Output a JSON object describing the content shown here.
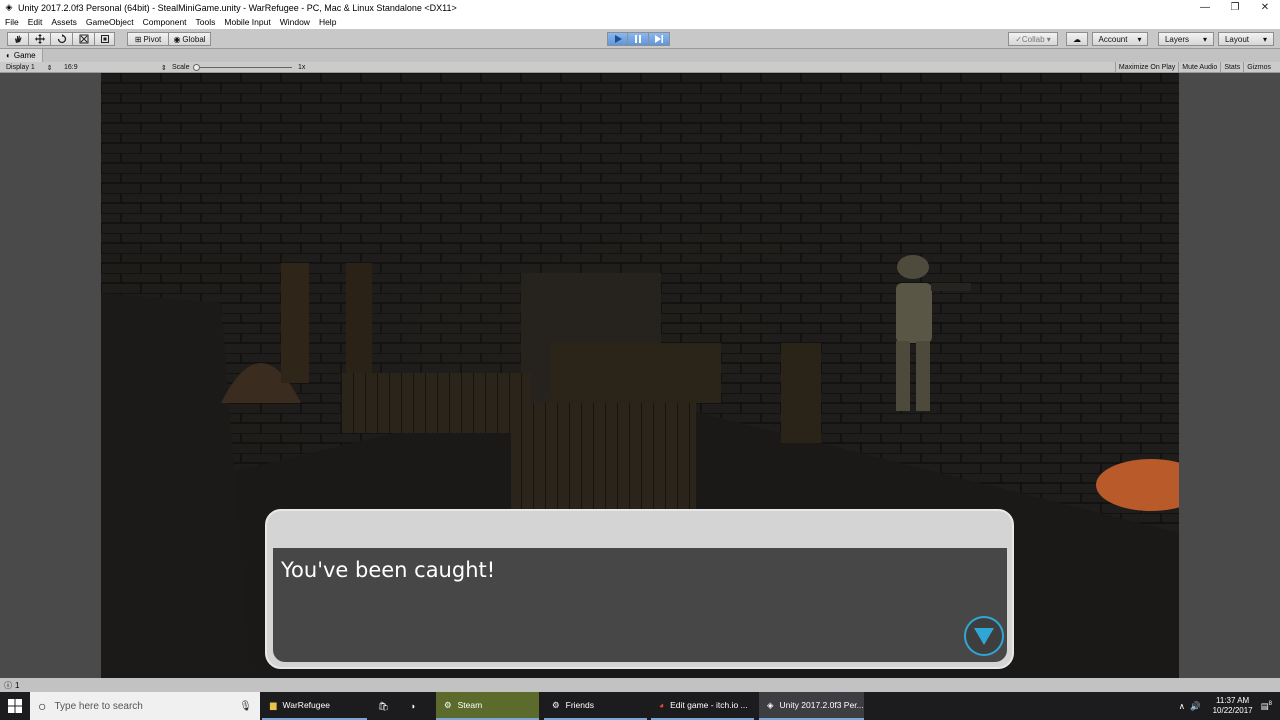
{
  "window": {
    "title": "Unity 2017.2.0f3 Personal (64bit) - StealMiniGame.unity - WarRefugee - PC, Mac & Linux Standalone <DX11>",
    "controls": [
      "minimize",
      "restore",
      "close"
    ]
  },
  "menu": {
    "items": [
      "File",
      "Edit",
      "Assets",
      "GameObject",
      "Component",
      "Tools",
      "Mobile Input",
      "Window",
      "Help"
    ]
  },
  "toolbar": {
    "pivot_label": "Pivot",
    "global_label": "Global",
    "collab_label": "Collab ▾",
    "account_label": "Account",
    "layers_label": "Layers",
    "layout_label": "Layout"
  },
  "game_tab": {
    "label": "Game",
    "display_label": "Display 1",
    "aspect_label": "16:9",
    "scale_label": "Scale",
    "scale_value": "1x",
    "buttons": [
      "Maximize On Play",
      "Mute Audio",
      "Stats",
      "Gizmos"
    ]
  },
  "dialog": {
    "text": "You've been caught!"
  },
  "statusbar": {
    "count": "1"
  },
  "taskbar": {
    "search_placeholder": "Type here to search",
    "apps": [
      {
        "label": "WarRefugee"
      },
      {
        "label": "Steam"
      },
      {
        "label": "Friends"
      },
      {
        "label": "Edit game - itch.io ..."
      },
      {
        "label": "Unity 2017.2.0f3 Per..."
      }
    ],
    "time": "11:37 AM",
    "date": "10/22/2017",
    "notification_count": "8"
  },
  "colors": {
    "accent_blue": "#2fa7d6",
    "play_active": "#5f96dc"
  }
}
